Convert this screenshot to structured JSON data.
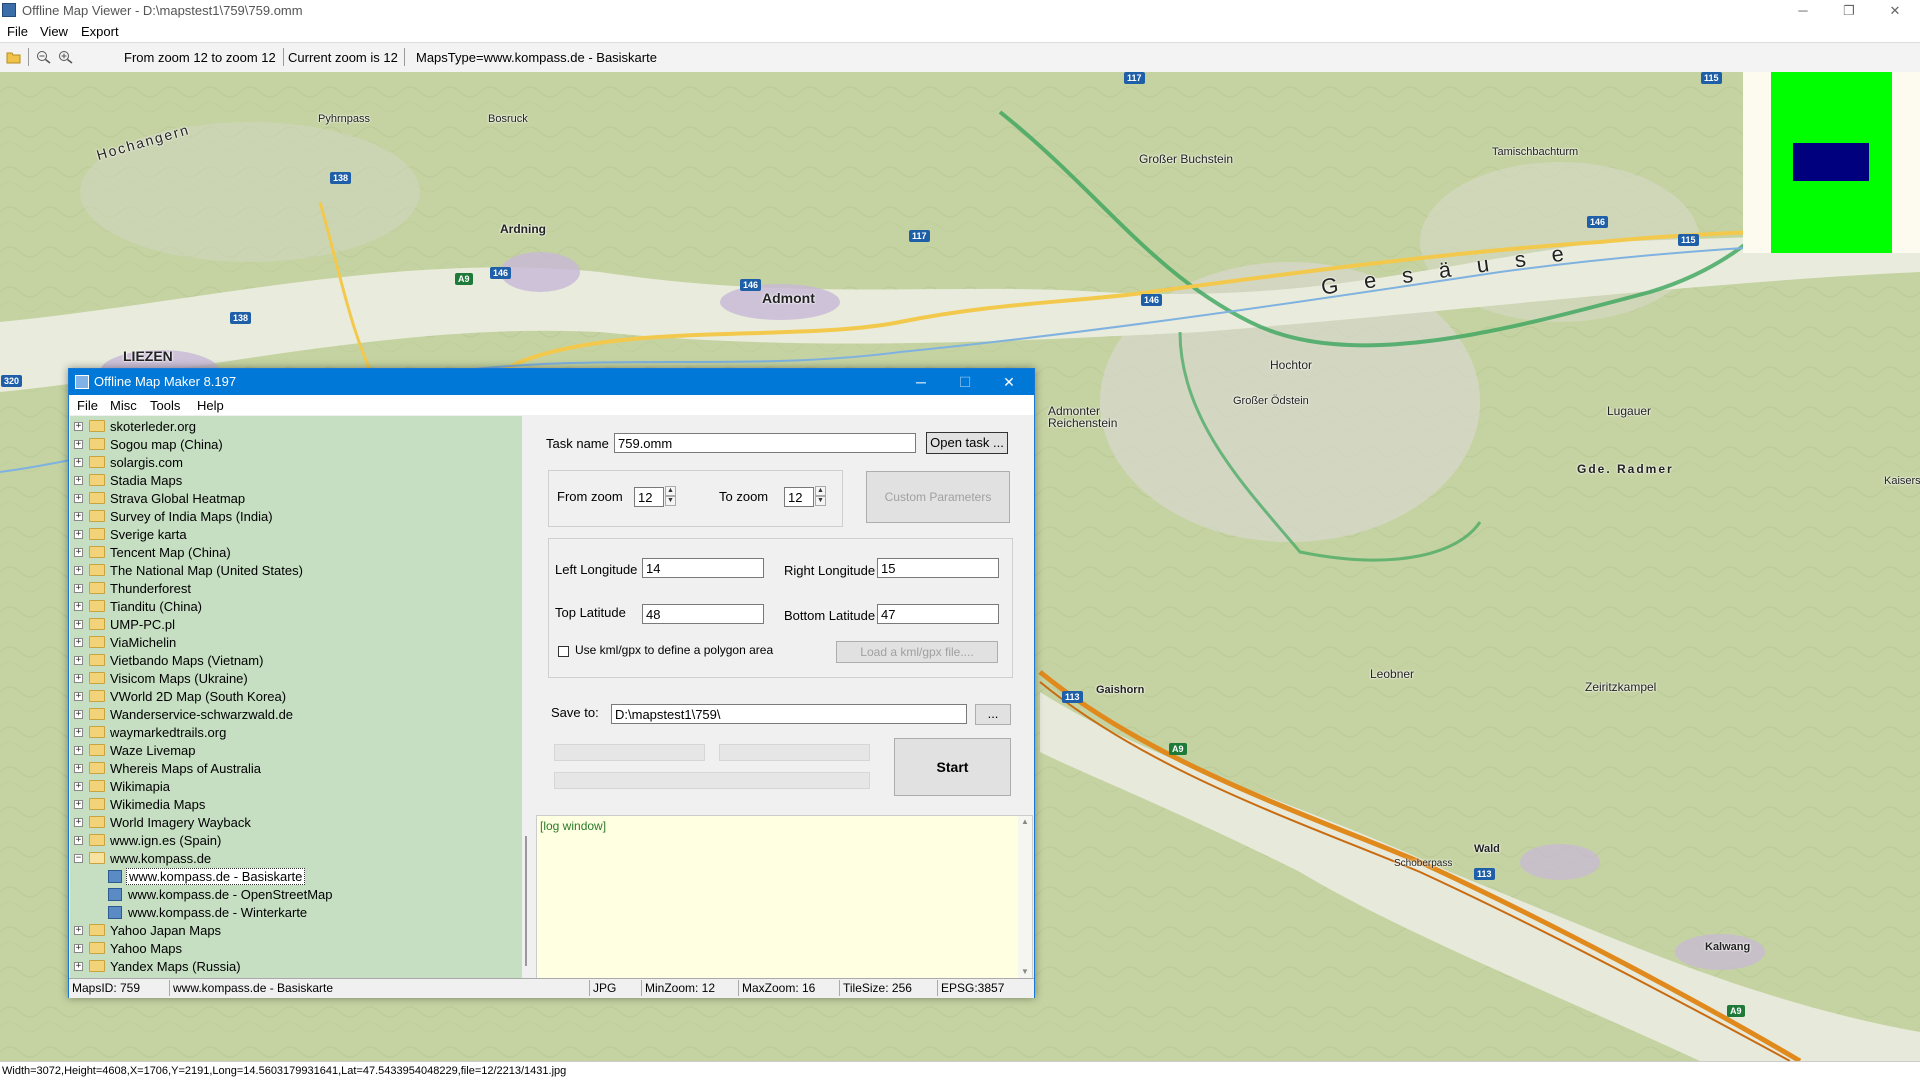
{
  "window": {
    "title": "Offline Map Viewer - D:\\mapstest1\\759\\759.omm",
    "controls": [
      "─",
      "❐",
      "✕"
    ]
  },
  "menu": [
    "File",
    "View",
    "Export"
  ],
  "toolbar": {
    "zoom_range": "From zoom 12 to zoom 12",
    "current_zoom": "Current zoom is 12",
    "maps_type": "MapsType=www.kompass.de - Basiskarte"
  },
  "map": {
    "labels": {
      "hochangern": "Hochangern",
      "pyhrnpass": "Pyhrnpass",
      "bosruck": "Bosruck",
      "ardning": "Ardning",
      "admont": "Admont",
      "liezen": "LIEZEN",
      "grosser_buchstein": "Großer Buchstein",
      "tamischbachturm": "Tamischbachturm",
      "gesause": "G e s ä u s e",
      "hochtor": "Hochtor",
      "grosser_odstein": "Großer Ödstein",
      "admonter_reichenstein": "Admonter Reichenstein",
      "lugauer": "Lugauer",
      "gde_radmer": "Gde. Radmer",
      "kaiserschild": "Kaisers",
      "leobner": "Leobner",
      "zeiritzkampel": "Zeiritzkampel",
      "gaishorn": "Gaishorn",
      "wald": "Wald",
      "schoberpass": "Schoberpass",
      "kalwang": "Kalwang"
    },
    "shields": {
      "s138a": "138",
      "s138b": "138",
      "s146a": "146",
      "s146b": "146",
      "s146c": "146",
      "s146d": "146",
      "s117a": "117",
      "s117b": "117",
      "s115a": "115",
      "s115b": "115",
      "sa9a": "A9",
      "sa9b": "A9",
      "sa9c": "A9",
      "s113a": "113",
      "s113b": "113",
      "s320": "320"
    }
  },
  "statusbar": "Width=3072,Height=4608,X=1706,Y=2191,Long=14.5603179931641,Lat=47.5433954048229,file=12/2213/1431.jpg",
  "dialog": {
    "title": "Offline Map Maker 8.197",
    "controls": [
      "─",
      "☐",
      "✕"
    ],
    "menu": [
      "File",
      "Misc",
      "Tools",
      "Help"
    ],
    "tree": [
      {
        "label": "skoterleder.org",
        "level": 0,
        "kind": "folder"
      },
      {
        "label": "Sogou map (China)",
        "level": 0,
        "kind": "folder"
      },
      {
        "label": "solargis.com",
        "level": 0,
        "kind": "folder"
      },
      {
        "label": "Stadia Maps",
        "level": 0,
        "kind": "folder"
      },
      {
        "label": "Strava Global Heatmap",
        "level": 0,
        "kind": "folder"
      },
      {
        "label": "Survey of India Maps (India)",
        "level": 0,
        "kind": "folder"
      },
      {
        "label": "Sverige karta",
        "level": 0,
        "kind": "folder"
      },
      {
        "label": "Tencent Map (China)",
        "level": 0,
        "kind": "folder"
      },
      {
        "label": "The National Map (United States)",
        "level": 0,
        "kind": "folder"
      },
      {
        "label": "Thunderforest",
        "level": 0,
        "kind": "folder"
      },
      {
        "label": "Tianditu (China)",
        "level": 0,
        "kind": "folder"
      },
      {
        "label": "UMP-PC.pl",
        "level": 0,
        "kind": "folder"
      },
      {
        "label": "ViaMichelin",
        "level": 0,
        "kind": "folder"
      },
      {
        "label": "Vietbando Maps (Vietnam)",
        "level": 0,
        "kind": "folder"
      },
      {
        "label": "Visicom Maps (Ukraine)",
        "level": 0,
        "kind": "folder"
      },
      {
        "label": "VWorld 2D Map (South Korea)",
        "level": 0,
        "kind": "folder"
      },
      {
        "label": "Wanderservice-schwarzwald.de",
        "level": 0,
        "kind": "folder"
      },
      {
        "label": "waymarkedtrails.org",
        "level": 0,
        "kind": "folder"
      },
      {
        "label": "Waze Livemap",
        "level": 0,
        "kind": "folder"
      },
      {
        "label": "Whereis Maps of Australia",
        "level": 0,
        "kind": "folder"
      },
      {
        "label": "Wikimapia",
        "level": 0,
        "kind": "folder"
      },
      {
        "label": "Wikimedia Maps",
        "level": 0,
        "kind": "folder"
      },
      {
        "label": "World Imagery Wayback",
        "level": 0,
        "kind": "folder"
      },
      {
        "label": "www.ign.es (Spain)",
        "level": 0,
        "kind": "folder"
      },
      {
        "label": "www.kompass.de",
        "level": 0,
        "kind": "folder-open"
      },
      {
        "label": "www.kompass.de - Basiskarte",
        "level": 1,
        "kind": "map",
        "selected": true
      },
      {
        "label": "www.kompass.de - OpenStreetMap",
        "level": 1,
        "kind": "map"
      },
      {
        "label": "www.kompass.de - Winterkarte",
        "level": 1,
        "kind": "map"
      },
      {
        "label": "Yahoo Japan Maps",
        "level": 0,
        "kind": "folder"
      },
      {
        "label": "Yahoo Maps",
        "level": 0,
        "kind": "folder"
      },
      {
        "label": "Yandex Maps (Russia)",
        "level": 0,
        "kind": "folder"
      }
    ],
    "form": {
      "task_name_label": "Task name",
      "task_name_value": "759.omm",
      "open_task": "Open task ...",
      "from_zoom_label": "From zoom",
      "from_zoom_value": "12",
      "to_zoom_label": "To zoom",
      "to_zoom_value": "12",
      "custom_parameters": "Custom Parameters",
      "left_longitude_label": "Left Longitude",
      "left_longitude_value": "14",
      "right_longitude_label": "Right Longitude",
      "right_longitude_value": "15",
      "top_latitude_label": "Top Latitude",
      "top_latitude_value": "48",
      "bottom_latitude_label": "Bottom Latitude",
      "bottom_latitude_value": "47",
      "kml_checkbox_label": "Use kml/gpx to define a polygon area",
      "load_kml": "Load a kml/gpx file....",
      "save_to_label": "Save to:",
      "save_to_value": "D:\\mapstest1\\759\\",
      "browse": "...",
      "start": "Start"
    },
    "log": "[log window]",
    "status": {
      "maps_id": "MapsID: 759",
      "maps_name": "www.kompass.de - Basiskarte",
      "format": "JPG",
      "min_zoom": "MinZoom: 12",
      "max_zoom": "MaxZoom: 16",
      "tile_size": "TileSize: 256",
      "epsg": "EPSG:3857"
    }
  },
  "colors": {
    "dialog_accent": "#0078d7",
    "tree_bg": "#c6dfc3",
    "log_bg": "#ffffe1",
    "minimap_green": "#00ff00",
    "minimap_blue": "#00007f"
  }
}
